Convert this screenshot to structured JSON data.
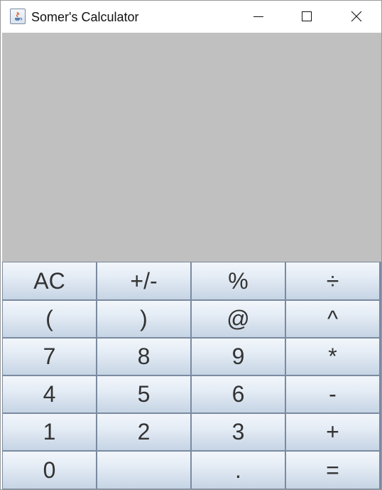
{
  "window": {
    "title": "Somer's Calculator",
    "icon": "java-app-icon",
    "controls": [
      "minimize-icon",
      "maximize-icon",
      "close-icon"
    ]
  },
  "display": {
    "value": "",
    "background": "#c0c0c0"
  },
  "keypad": {
    "rows": [
      [
        {
          "label": "AC",
          "name": "clear"
        },
        {
          "label": "+/-",
          "name": "negate"
        },
        {
          "label": "%",
          "name": "percent"
        },
        {
          "label": "÷",
          "name": "divide"
        }
      ],
      [
        {
          "label": "(",
          "name": "open-paren"
        },
        {
          "label": ")",
          "name": "close-paren"
        },
        {
          "label": "@",
          "name": "at"
        },
        {
          "label": "^",
          "name": "power"
        }
      ],
      [
        {
          "label": "7",
          "name": "7"
        },
        {
          "label": "8",
          "name": "8"
        },
        {
          "label": "9",
          "name": "9"
        },
        {
          "label": "*",
          "name": "multiply"
        }
      ],
      [
        {
          "label": "4",
          "name": "4"
        },
        {
          "label": "5",
          "name": "5"
        },
        {
          "label": "6",
          "name": "6"
        },
        {
          "label": "-",
          "name": "subtract"
        }
      ],
      [
        {
          "label": "1",
          "name": "1"
        },
        {
          "label": "2",
          "name": "2"
        },
        {
          "label": "3",
          "name": "3"
        },
        {
          "label": "+",
          "name": "add"
        }
      ],
      [
        {
          "label": "0",
          "name": "0"
        },
        {
          "label": "",
          "name": "blank"
        },
        {
          "label": ".",
          "name": "decimal"
        },
        {
          "label": "=",
          "name": "equals"
        }
      ]
    ]
  },
  "colors": {
    "button_top": "#f2f6fb",
    "button_bottom": "#c6d4e4",
    "button_border": "#7a8aa0",
    "label_text": "#333333"
  }
}
